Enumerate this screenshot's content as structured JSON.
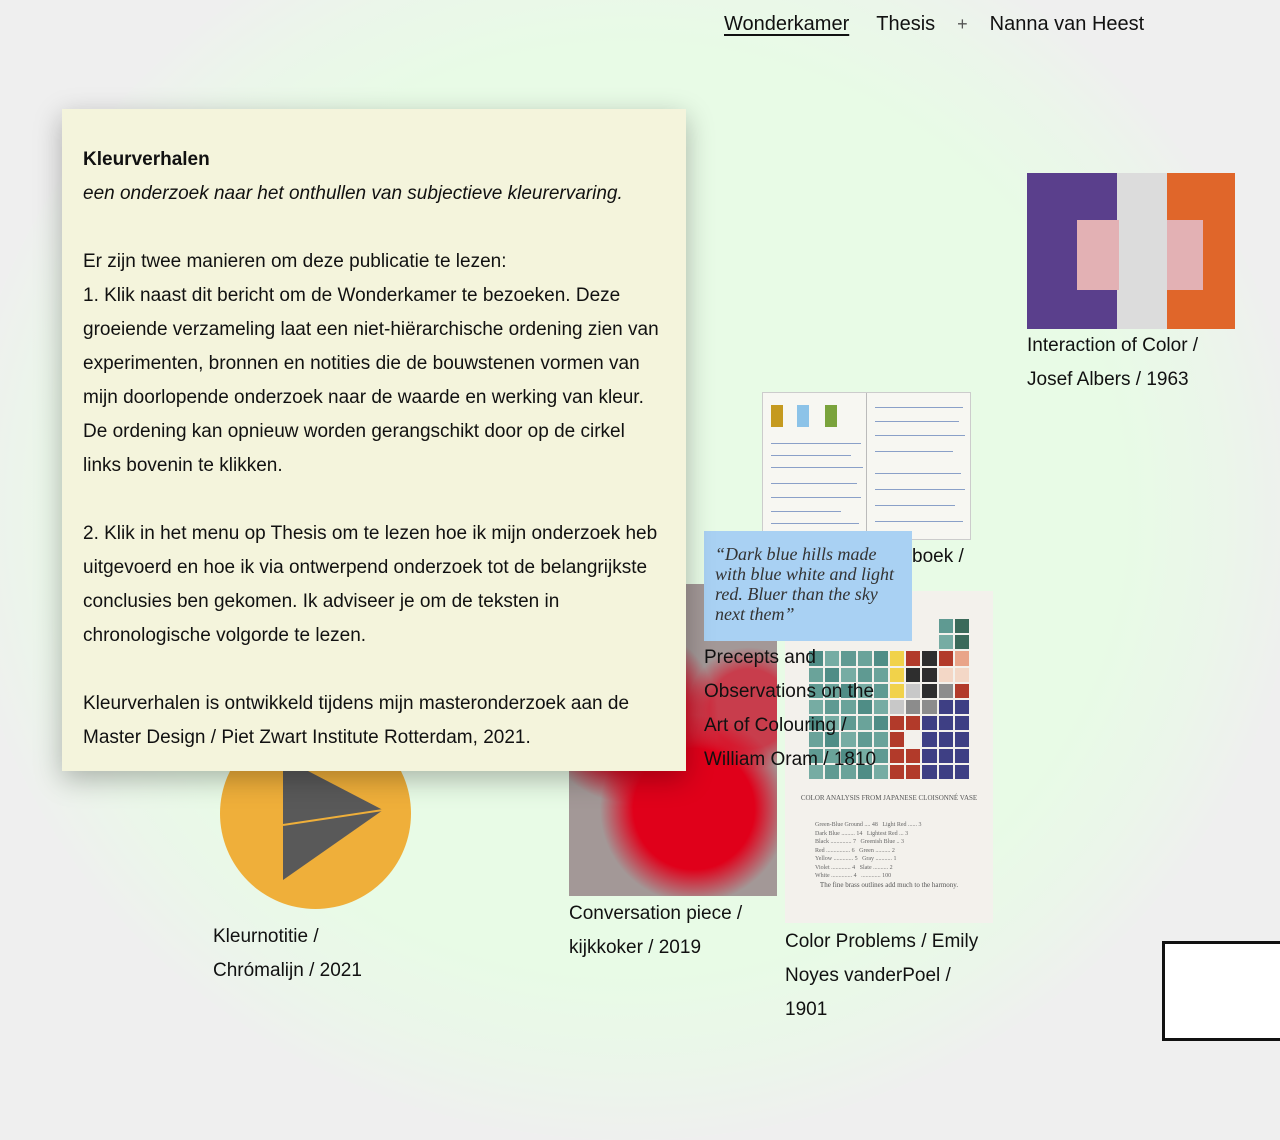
{
  "nav": {
    "items": [
      "Wonderkamer",
      "Thesis",
      "+",
      "Nanna van Heest"
    ]
  },
  "intro": {
    "title": "Kleurverhalen",
    "subtitle": "een onderzoek naar het onthullen van subjectieve kleurervaring.",
    "p1": "Er zijn twee manieren om deze publicatie te lezen:",
    "p2": "1. Klik naast dit bericht om de Wonderkamer te bezoeken. Deze groeiende verzameling laat een niet-hiërarchische ordening zien van experimenten, bronnen en notities die de bouwstenen vormen van mijn doorlopende onderzoek naar de waarde en werking van kleur. De ordening kan opnieuw worden gerangschikt door op de cirkel links bovenin te klikken.",
    "p3": "2. Klik in het menu op Thesis om te lezen hoe ik mijn onderzoek heb uitgevoerd en hoe ik via ontwerpend onderzoek tot de belangrijkste conclusies ben gekomen. Ik adviseer je om de teksten in chronologische volgorde te lezen.",
    "p4": "Kleurverhalen is ontwikkeld tijdens mijn masteronderzoek aan de Master Design / Piet Zwart Institute Rotterdam, 2021."
  },
  "items": {
    "albers": {
      "line1": "Interaction of Color /",
      "line2": "Josef Albers / 1963"
    },
    "notebook": {
      "caption_fragment": "boek /"
    },
    "quote": {
      "text": "“Dark blue hills made with blue white and light red. Bluer than the sky next them”"
    },
    "oram": {
      "line1": "Precepts and",
      "line2": "Observations on the",
      "line3": "Art of Colouring /",
      "line4": "William Oram / 1810"
    },
    "conversation": {
      "line1": "Conversation piece /",
      "line2": "kijkkoker / 2019"
    },
    "poel": {
      "line1": "Color Problems / Emily",
      "line2": "Noyes vanderPoel /",
      "line3": "1901",
      "plate_title": "COLOR ANALYSIS FROM JAPANESE CLOISONNÉ VASE",
      "plate_note": "The fine brass outlines add much to the harmony."
    },
    "kleurnotitie": {
      "line1": "Kleurnotitie /",
      "line2": "Chrómalijn / 2021"
    }
  },
  "colors": {
    "background": "#efefef",
    "glow": "#e8fbe6",
    "panel": "#f4f4dc",
    "quote": "#a9d1f3",
    "play": "#efaf3a",
    "play_icon": "#595959"
  }
}
